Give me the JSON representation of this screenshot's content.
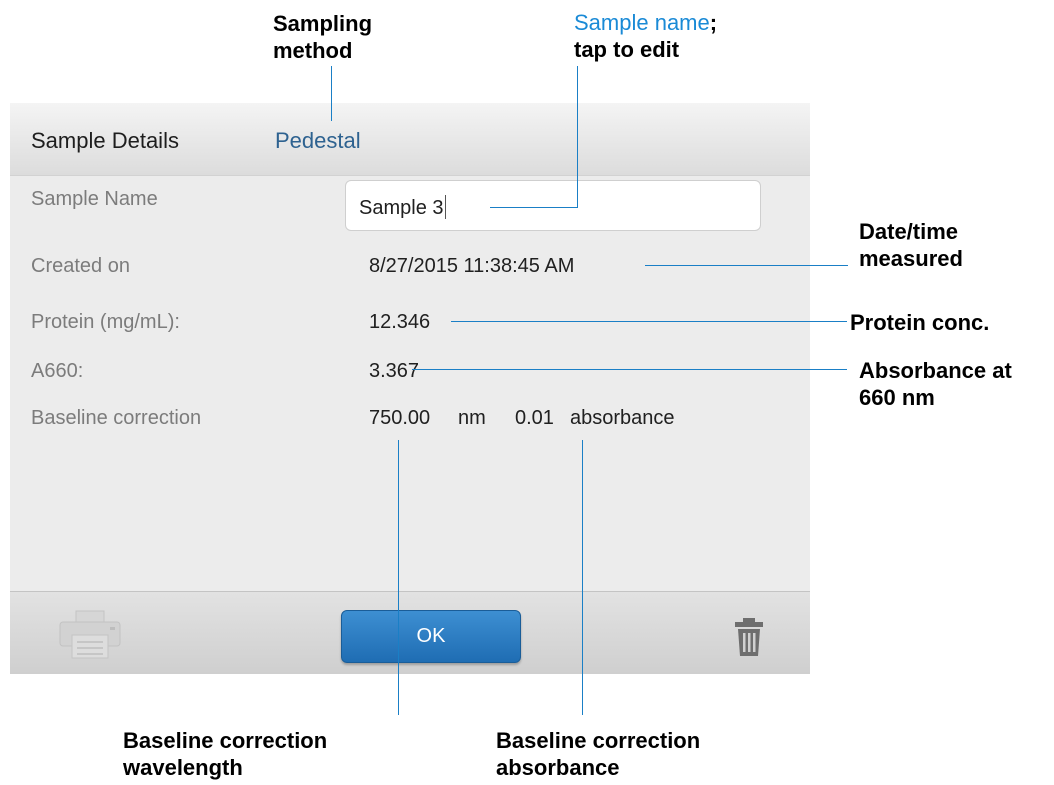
{
  "callouts": {
    "sampling_method": [
      "Sampling",
      "method"
    ],
    "sample_name_blue": "Sample name",
    "sample_name_punct": ";",
    "sample_name_line2": "tap to edit",
    "date_time": [
      "Date/time",
      "measured"
    ],
    "protein": "Protein conc.",
    "absorbance": [
      "Absorbance at",
      "660 nm"
    ],
    "baseline_wavelength": [
      "Baseline correction",
      "wavelength"
    ],
    "baseline_absorbance": [
      "Baseline correction",
      "absorbance"
    ]
  },
  "dialog": {
    "title": "Sample Details",
    "sampling_method": "Pedestal",
    "fields": {
      "sample_name": {
        "label": "Sample Name",
        "value": "Sample 3"
      },
      "created_on": {
        "label": "Created on",
        "value": "8/27/2015 11:38:45 AM"
      },
      "protein": {
        "label": "Protein (mg/mL):",
        "value": "12.346"
      },
      "a660": {
        "label": "A660:",
        "value": "3.367"
      },
      "baseline": {
        "label": "Baseline correction",
        "wavelength_value": "750.00",
        "wavelength_unit": "nm",
        "absorbance_value": "0.01",
        "absorbance_unit": "absorbance"
      }
    },
    "footer": {
      "print_icon": "printer-icon",
      "ok_label": "OK",
      "delete_icon": "trash-icon"
    }
  },
  "colors": {
    "accent": "#1a7fc6",
    "method_text": "#2e6290",
    "ok_button": "#2a7cc2",
    "panel_bg": "#ececec"
  }
}
